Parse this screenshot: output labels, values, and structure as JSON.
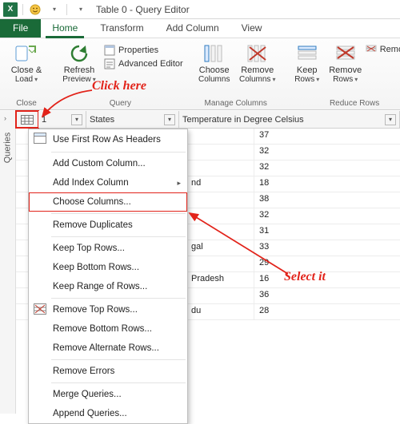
{
  "titlebar": {
    "title": "Table 0 - Query Editor"
  },
  "tabs": {
    "file": "File",
    "home": "Home",
    "transform": "Transform",
    "addcol": "Add Column",
    "view": "View"
  },
  "ribbon": {
    "close": {
      "label1": "Close &",
      "label2": "Load",
      "group": "Close"
    },
    "query": {
      "refresh1": "Refresh",
      "refresh2": "Preview",
      "properties": "Properties",
      "advanced": "Advanced Editor",
      "group": "Query"
    },
    "manage": {
      "choose1": "Choose",
      "choose2": "Columns",
      "remove1": "Remove",
      "remove2": "Columns",
      "group": "Manage Columns"
    },
    "reduce": {
      "keep1": "Keep",
      "keep2": "Rows",
      "remove1": "Remove",
      "remove2": "Rows",
      "removerowslabel": "Remove F",
      "group": "Reduce Rows"
    }
  },
  "sidebar": {
    "label": "Queries"
  },
  "headers": {
    "id": "1",
    "states": "States",
    "temp": "Temperature in Degree Celsius"
  },
  "rows": [
    {
      "state": "",
      "temp": "37"
    },
    {
      "state": "",
      "temp": "32"
    },
    {
      "state": "",
      "temp": "32"
    },
    {
      "state": "nd",
      "temp": "18"
    },
    {
      "state": "",
      "temp": "38"
    },
    {
      "state": "",
      "temp": "32"
    },
    {
      "state": "",
      "temp": "31"
    },
    {
      "state": "gal",
      "temp": "33"
    },
    {
      "state": "",
      "temp": "29"
    },
    {
      "state": "Pradesh",
      "temp": "16"
    },
    {
      "state": "",
      "temp": "36"
    },
    {
      "state": "du",
      "temp": "28"
    }
  ],
  "menu": {
    "firstrow": "Use First Row As Headers",
    "addcustom": "Add Custom Column...",
    "addindex": "Add Index Column",
    "choose": "Choose Columns...",
    "removedup": "Remove Duplicates",
    "keeptop": "Keep Top Rows...",
    "keepbottom": "Keep Bottom Rows...",
    "keeprange": "Keep Range of Rows...",
    "removetop": "Remove Top Rows...",
    "removebottom": "Remove Bottom Rows...",
    "removealt": "Remove Alternate Rows...",
    "removeerr": "Remove Errors",
    "merge": "Merge Queries...",
    "append": "Append Queries..."
  },
  "annotations": {
    "click": "Click here",
    "select": "Select it"
  }
}
